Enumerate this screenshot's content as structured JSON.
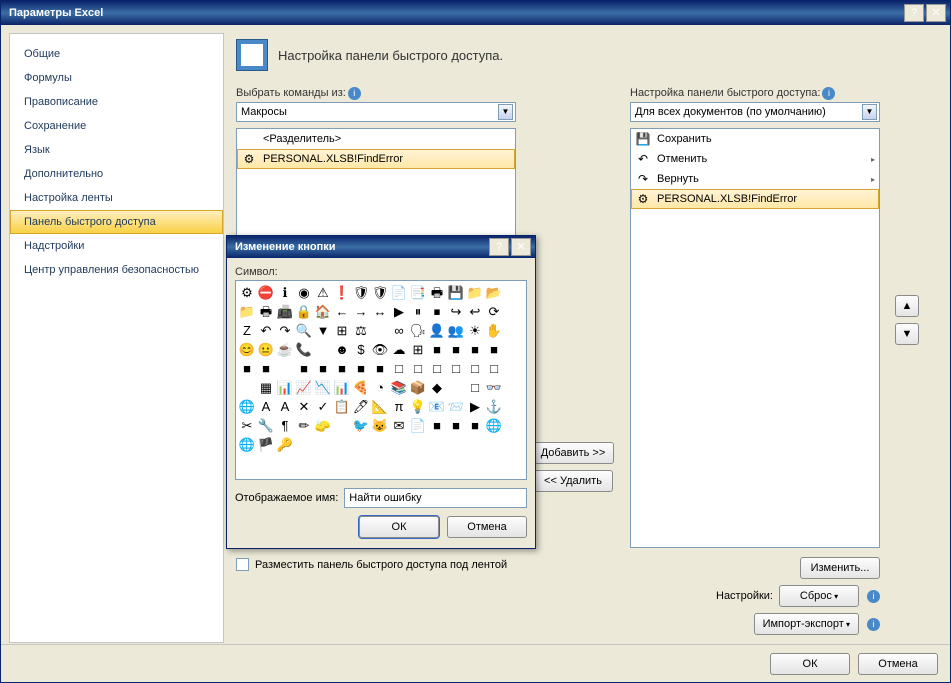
{
  "window": {
    "title": "Параметры Excel",
    "help": "?",
    "close": "✕"
  },
  "sidebar": {
    "items": [
      "Общие",
      "Формулы",
      "Правописание",
      "Сохранение",
      "Язык",
      "Дополнительно",
      "Настройка ленты",
      "Панель быстрого доступа",
      "Надстройки",
      "Центр управления безопасностью"
    ],
    "selected": 7
  },
  "header": {
    "text": "Настройка панели быстрого доступа."
  },
  "left": {
    "label": "Выбрать команды из:",
    "combo": "Макросы",
    "items": [
      {
        "icon": "",
        "text": "<Разделитель>"
      },
      {
        "icon": "⚙",
        "text": "PERSONAL.XLSB!FindError"
      }
    ],
    "selected": 1
  },
  "mid": {
    "add": "Добавить >>",
    "remove": "<< Удалить"
  },
  "right": {
    "label": "Настройка панели быстрого доступа:",
    "combo": "Для всех документов (по умолчанию)",
    "items": [
      {
        "icon": "💾",
        "text": "Сохранить",
        "expand": false
      },
      {
        "icon": "↶",
        "text": "Отменить",
        "expand": true
      },
      {
        "icon": "↷",
        "text": "Вернуть",
        "expand": true
      },
      {
        "icon": "⚙",
        "text": "PERSONAL.XLSB!FindError",
        "expand": false
      }
    ],
    "selected": 3
  },
  "arrows": {
    "up": "▲",
    "down": "▼"
  },
  "right_controls": {
    "modify": "Изменить...",
    "settings_label": "Настройки:",
    "reset": "Сброс",
    "import": "Импорт-экспорт"
  },
  "checkbox": {
    "label": "Разместить панель быстрого доступа под лентой"
  },
  "footer": {
    "ok": "ОК",
    "cancel": "Отмена"
  },
  "subdialog": {
    "title": "Изменение кнопки",
    "symbol_label": "Символ:",
    "name_label": "Отображаемое имя:",
    "name_value": "Найти ошибку",
    "ok": "ОК",
    "cancel": "Отмена",
    "icons": [
      "⚙",
      "⛔",
      "ℹ",
      "◉",
      "⚠",
      "❗",
      "🛡",
      "🛡",
      "📄",
      "📑",
      "🖶",
      "💾",
      "📁",
      "📂",
      "📁",
      "🖶",
      "📠",
      "🔒",
      "🏠",
      "←",
      "→",
      "↔",
      "▶",
      "⏸",
      "⏹",
      "↪",
      "↩",
      "⟳",
      "Z",
      "↶",
      "↷",
      "🔍",
      "▼",
      "⊞",
      "⚖",
      "",
      "∞",
      "🗣",
      "👤",
      "👥",
      "☀",
      "✋",
      "😊",
      "😐",
      "☕",
      "📞",
      "",
      "☻",
      "$",
      "👁",
      "☁",
      "⊞",
      "■",
      "■",
      "■",
      "■",
      "■",
      "■",
      "",
      "■",
      "■",
      "■",
      "■",
      "■",
      "□",
      "□",
      "□",
      "□",
      "□",
      "□",
      "",
      "▦",
      "📊",
      "📈",
      "📉",
      "📊",
      "🍕",
      "◔",
      "📚",
      "📦",
      "◆",
      "",
      "□",
      "👓",
      "🌐",
      "A",
      "A",
      "✕",
      "✓",
      "📋",
      "🖊",
      "📐",
      "π",
      "💡",
      "📧",
      "📨",
      "▶",
      "⚓",
      "✂",
      "🔧",
      "¶",
      "✏",
      "🧽",
      "",
      "🐦",
      "😺",
      "✉",
      "📄",
      "■",
      "■",
      "■",
      "🌐",
      "🌐",
      "🏴",
      "🔑"
    ]
  }
}
